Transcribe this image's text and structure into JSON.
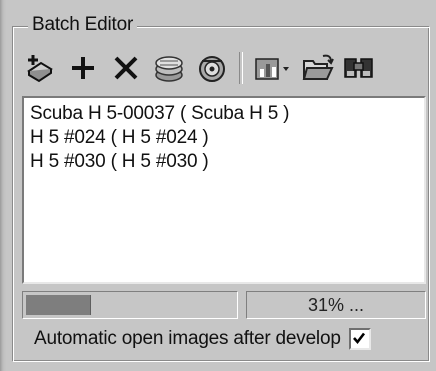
{
  "panel": {
    "title": "Batch Editor"
  },
  "toolbar": {
    "buttons": [
      {
        "name": "add-from-scanner",
        "icon": "scanner-add-icon"
      },
      {
        "name": "add",
        "icon": "plus-icon"
      },
      {
        "name": "remove",
        "icon": "x-icon"
      },
      {
        "name": "stack-1",
        "icon": "film-stack-icon"
      },
      {
        "name": "stack-2",
        "icon": "film-reel-icon"
      },
      {
        "name": "settings-dropdown",
        "icon": "chart-dropdown-icon"
      },
      {
        "name": "open-folder",
        "icon": "open-folder-icon"
      },
      {
        "name": "find",
        "icon": "binoculars-icon"
      }
    ]
  },
  "list": {
    "items": [
      "Scuba H 5-00037 ( Scuba H 5 )",
      "H 5 #024 ( H 5 #024 )",
      "H 5 #030 ( H 5 #030 )"
    ]
  },
  "status": {
    "progress": 0.31,
    "percent_text": "31% ..."
  },
  "options": {
    "auto_open_label": "Automatic open images after develop",
    "auto_open_checked": true
  },
  "colors": {
    "panel_bg": "#c6c6c6",
    "progress_fill": "#7e7e7e"
  }
}
